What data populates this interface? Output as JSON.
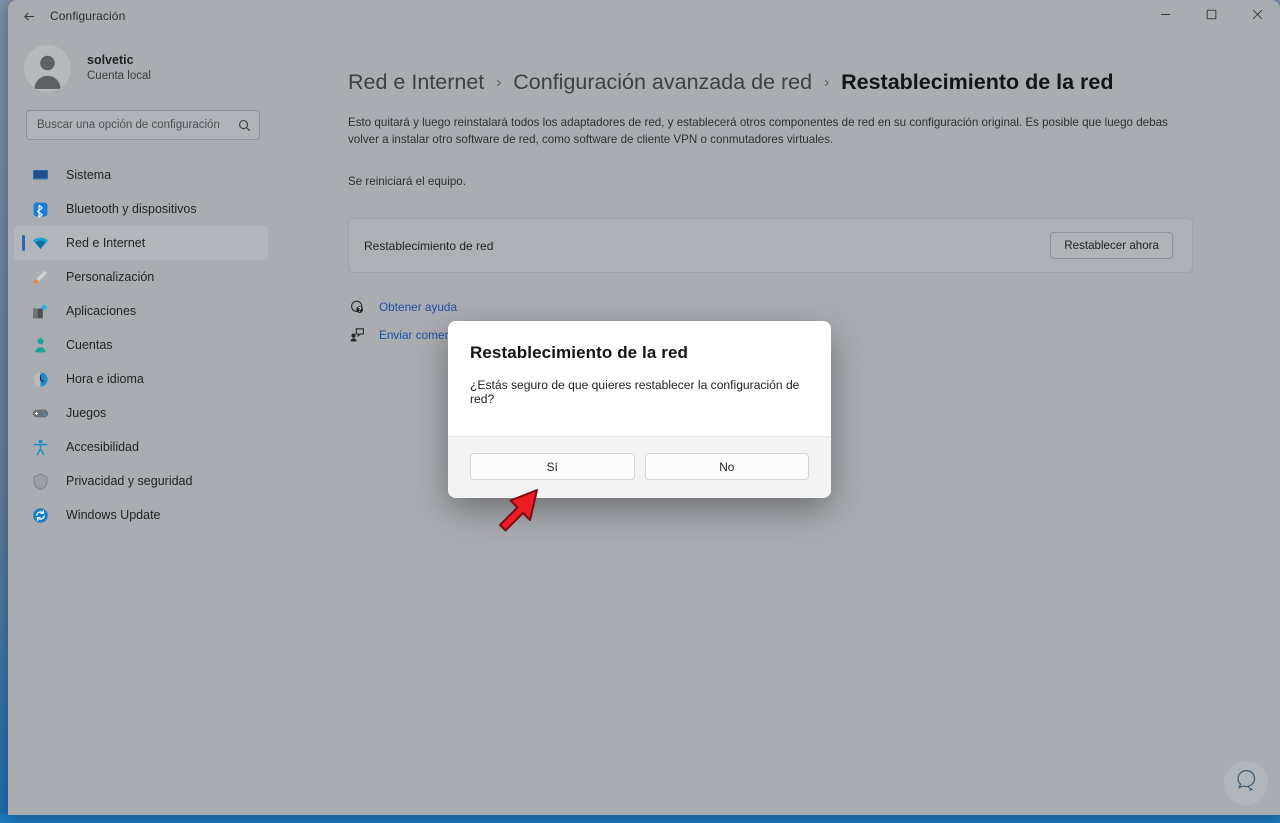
{
  "window": {
    "title": "Configuración",
    "back_icon": "back-arrow-icon",
    "controls": {
      "minimize": "minimize-icon",
      "maximize": "maximize-icon",
      "close": "close-icon"
    }
  },
  "sidebar": {
    "account": {
      "name": "solvetic",
      "type": "Cuenta local",
      "avatar_icon": "avatar-icon"
    },
    "search": {
      "placeholder": "Buscar una opción de configuración",
      "value": "",
      "icon": "search-icon"
    },
    "items": [
      {
        "label": "Sistema",
        "icon": "system-icon",
        "selected": false
      },
      {
        "label": "Bluetooth y dispositivos",
        "icon": "bluetooth-icon",
        "selected": false
      },
      {
        "label": "Red e Internet",
        "icon": "wifi-icon",
        "selected": true
      },
      {
        "label": "Personalización",
        "icon": "brush-icon",
        "selected": false
      },
      {
        "label": "Aplicaciones",
        "icon": "apps-icon",
        "selected": false
      },
      {
        "label": "Cuentas",
        "icon": "account-icon",
        "selected": false
      },
      {
        "label": "Hora e idioma",
        "icon": "clock-icon",
        "selected": false
      },
      {
        "label": "Juegos",
        "icon": "gamepad-icon",
        "selected": false
      },
      {
        "label": "Accesibilidad",
        "icon": "accessibility-icon",
        "selected": false
      },
      {
        "label": "Privacidad y seguridad",
        "icon": "shield-icon",
        "selected": false
      },
      {
        "label": "Windows Update",
        "icon": "update-icon",
        "selected": false
      }
    ]
  },
  "main": {
    "breadcrumb": {
      "first": "Red e Internet",
      "separator": "›",
      "second": "Configuración avanzada de red",
      "current": "Restablecimiento de la red"
    },
    "description_1": "Esto quitará y luego reinstalará todos los adaptadores de red, y establecerá otros componentes de red en su configuración original. Es posible que luego debas volver a instalar otro software de red, como software de cliente VPN o conmutadores virtuales.",
    "description_2": "Se reiniciará el equipo.",
    "reset_card": {
      "label": "Restablecimiento de red",
      "button": "Restablecer ahora"
    },
    "links": [
      {
        "label": "Obtener ayuda",
        "icon": "help-icon"
      },
      {
        "label": "Enviar comentarios",
        "icon": "feedback-icon"
      }
    ],
    "feedback_bubble_icon": "feedback-bubble-icon"
  },
  "dialog": {
    "title": "Restablecimiento de la red",
    "message": "¿Estás seguro de que quieres restablecer la configuración de red?",
    "confirm_label": "Sí",
    "cancel_label": "No"
  },
  "annotation": {
    "arrow_icon": "red-arrow-pointer",
    "arrow_color": "#ee1c25"
  },
  "colors": {
    "accent": "#2a66b8",
    "window_bg": "#a9acb1",
    "link": "#1e4fa3"
  }
}
